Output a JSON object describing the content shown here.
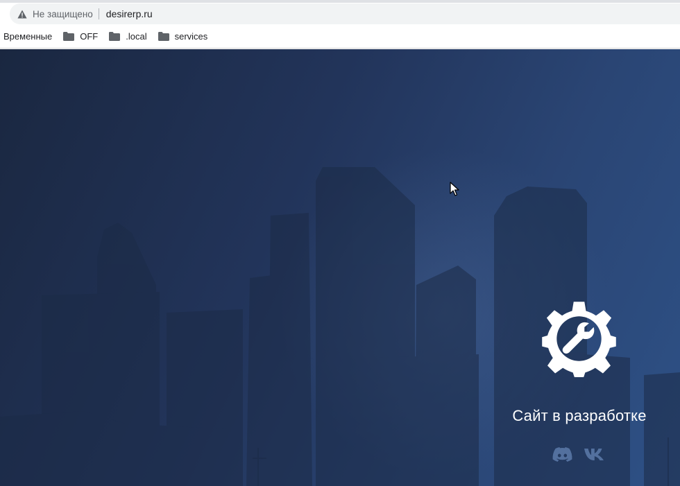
{
  "browser": {
    "security_label": "Не защищено",
    "url": "desirerp.ru",
    "bookmarks": [
      {
        "label": "Временные",
        "icon": "none"
      },
      {
        "label": "OFF",
        "icon": "folder-icon"
      },
      {
        "label": ".local",
        "icon": "folder-icon"
      },
      {
        "label": "services",
        "icon": "folder-icon"
      }
    ]
  },
  "page": {
    "status_text": "Сайт в разработке",
    "gear_icon": "gear-wrench-icon",
    "socials": [
      "discord-icon",
      "vk-icon"
    ],
    "colors": {
      "background_dark": "#1a2740",
      "background_light": "#2e5186",
      "text": "#ffffff"
    }
  }
}
